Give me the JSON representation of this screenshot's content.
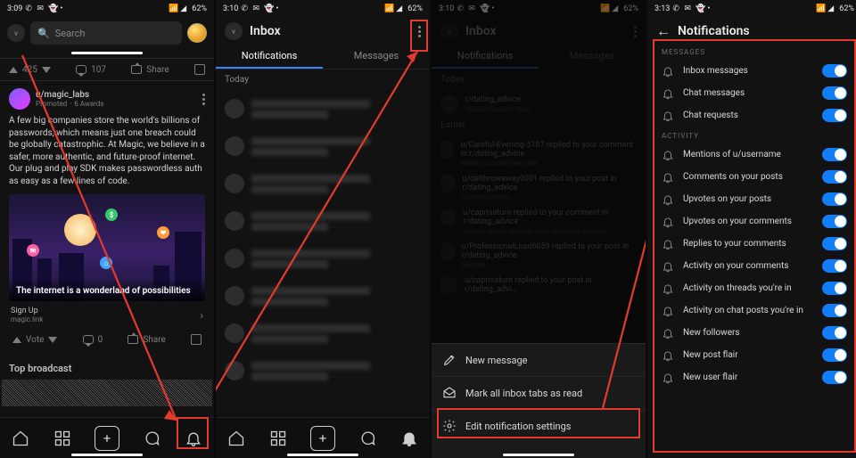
{
  "status": {
    "times": [
      "3:09",
      "3:10",
      "3:10",
      "3:13"
    ],
    "battery": "62%",
    "icons": [
      "phone",
      "whatsapp",
      "snapchat",
      "slack"
    ]
  },
  "screen1": {
    "search_placeholder": "Search",
    "vote_up": "425",
    "comments_top": "107",
    "share_label": "Share",
    "post_user": "u/magic_labs",
    "promoted": "Promoted",
    "awards": "6 Awards",
    "post_body": "A few big companies store the world's billions of passwords, which means just one breach could be globally catastrophic. At Magic, we believe in a safer, more authentic, and future-proof internet. Our plug and play SDK makes passwordless auth as easy as a few lines of code.",
    "image_caption": "The internet is a wonderland of possibilities",
    "signup_label": "Sign Up",
    "signup_sub": "magic.link",
    "vote_label": "Vote",
    "comments_bottom": "0",
    "section": "Top broadcast"
  },
  "screen2": {
    "title": "Inbox",
    "tab_notifications": "Notifications",
    "tab_messages": "Messages",
    "today": "Today"
  },
  "screen3": {
    "title": "Inbox",
    "tab_notifications": "Notifications",
    "tab_messages": "Messages",
    "today": "Today",
    "earlier": "Earlier",
    "replies": [
      {
        "u": "r/dating_advice",
        "b": "…"
      },
      {
        "u": "u/Careful-Evening-5187 replied to your comment in r/dating_advice",
        "b": "…"
      },
      {
        "u": "u/delthrowaway9001 replied to your post in r/dating_advice",
        "b": "…"
      },
      {
        "u": "u/caprisaturn replied to your comment in r/dating_advice",
        "b": "…"
      },
      {
        "u": "u/ProfessionalLoad6059 replied to your post in r/dating_advice",
        "b": "…"
      },
      {
        "u": "u/caprisaturn replied to your post in r/dating_advi…",
        "b": "…"
      }
    ],
    "menu_new_message": "New message",
    "menu_mark_read": "Mark all inbox tabs as read",
    "menu_edit_settings": "Edit notification settings"
  },
  "screen4": {
    "title": "Notifications",
    "section_messages": "MESSAGES",
    "section_activity": "ACTIVITY",
    "rows_messages": [
      "Inbox messages",
      "Chat messages",
      "Chat requests"
    ],
    "rows_activity": [
      "Mentions of u/username",
      "Comments on your posts",
      "Upvotes on your posts",
      "Upvotes on your comments",
      "Replies to your comments",
      "Activity on your comments",
      "Activity on threads you're in",
      "Activity on chat posts you're in",
      "New followers",
      "New post flair",
      "New user flair"
    ]
  }
}
